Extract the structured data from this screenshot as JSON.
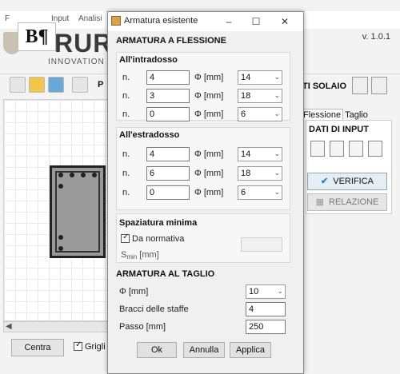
{
  "background_app": {
    "menu_items": [
      "F",
      "Input",
      "Analisi"
    ],
    "logo_text": "RURI",
    "logo_subtitle": "INNOVATION &",
    "version": "v. 1.0.1",
    "toolbar_label": "P",
    "solaio_label": "TI SOLAIO",
    "tabs": [
      "Flessione",
      "Taglio"
    ],
    "dati_title": "DATI DI INPUT",
    "verifica_label": "VERIFICA",
    "relazione_label": "RELAZIONE",
    "centra_label": "Centra",
    "griglia_label": "Grigli",
    "griglia_checked": true
  },
  "dialog": {
    "title": "Armatura esistente",
    "controls": [
      "–",
      "☐",
      "✕"
    ],
    "flessione": {
      "title": "ARMATURA A FLESSIONE",
      "intradosso": {
        "title": "All'intradosso",
        "rows": [
          {
            "n_label": "n.",
            "n": "4",
            "phi_label": "Φ [mm]",
            "phi": "14"
          },
          {
            "n_label": "n.",
            "n": "3",
            "phi_label": "Φ [mm]",
            "phi": "18"
          },
          {
            "n_label": "n.",
            "n": "0",
            "phi_label": "Φ [mm]",
            "phi": "6"
          }
        ]
      },
      "estradosso": {
        "title": "All'estradosso",
        "rows": [
          {
            "n_label": "n.",
            "n": "4",
            "phi_label": "Φ [mm]",
            "phi": "14"
          },
          {
            "n_label": "n.",
            "n": "6",
            "phi_label": "Φ [mm]",
            "phi": "18"
          },
          {
            "n_label": "n.",
            "n": "0",
            "phi_label": "Φ [mm]",
            "phi": "6"
          }
        ]
      },
      "spaziatura": {
        "title": "Spaziatura minima",
        "da_normativa_label": "Da normativa",
        "da_normativa_checked": true,
        "smin_label_main": "S",
        "smin_label_sub": "min",
        "smin_label_unit": " [mm]",
        "smin_value": ""
      }
    },
    "taglio": {
      "title": "ARMATURA AL TAGLIO",
      "phi_label": "Φ [mm]",
      "phi_value": "10",
      "bracci_label": "Bracci delle staffe",
      "bracci_value": "4",
      "passo_label": "Passo [mm]",
      "passo_value": "250"
    },
    "buttons": {
      "ok": "Ok",
      "annulla": "Annulla",
      "applica": "Applica"
    }
  }
}
